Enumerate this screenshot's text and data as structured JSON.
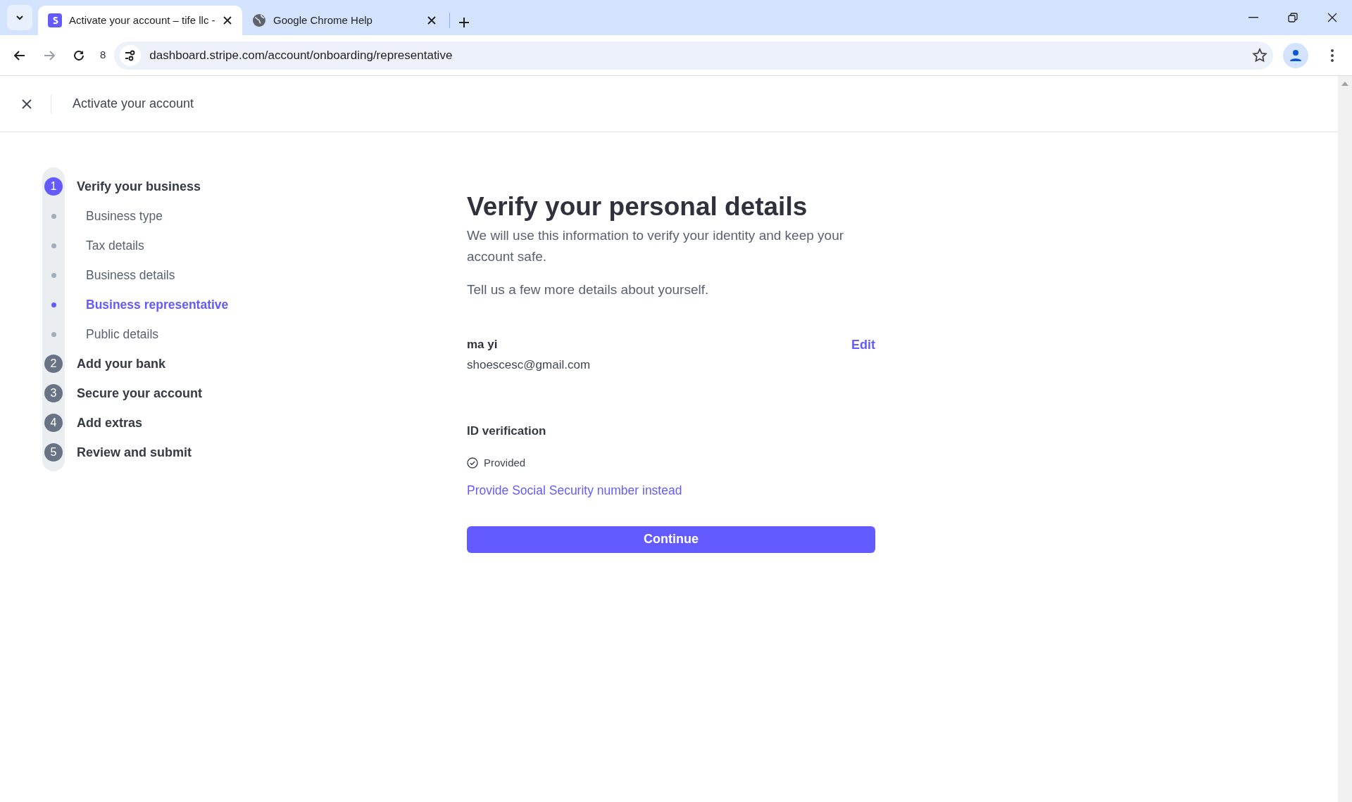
{
  "browser": {
    "tabs": [
      {
        "title": "Activate your account – tife llc -",
        "selected": true
      },
      {
        "title": "Google Chrome Help",
        "selected": false
      }
    ],
    "reload_count": "8",
    "url": "dashboard.stripe.com/account/onboarding/representative"
  },
  "header": {
    "title": "Activate your account"
  },
  "steps": [
    {
      "number": "1",
      "label": "Verify your business",
      "active": true,
      "substeps": [
        {
          "label": "Business type",
          "selected": false
        },
        {
          "label": "Tax details",
          "selected": false
        },
        {
          "label": "Business details",
          "selected": false
        },
        {
          "label": "Business representative",
          "selected": true
        },
        {
          "label": "Public details",
          "selected": false
        }
      ]
    },
    {
      "number": "2",
      "label": "Add your bank",
      "active": false
    },
    {
      "number": "3",
      "label": "Secure your account",
      "active": false
    },
    {
      "number": "4",
      "label": "Add extras",
      "active": false
    },
    {
      "number": "5",
      "label": "Review and submit",
      "active": false
    }
  ],
  "main": {
    "heading": "Verify your personal details",
    "intro": "We will use this information to verify your identity and keep your account safe.",
    "prompt": "Tell us a few more details about yourself.",
    "person": {
      "name": "ma yi",
      "email": "shoescesc@gmail.com",
      "edit": "Edit"
    },
    "id_verification": {
      "title": "ID verification",
      "status": "Provided",
      "alt_link": "Provide Social Security number instead"
    },
    "continue": "Continue"
  }
}
